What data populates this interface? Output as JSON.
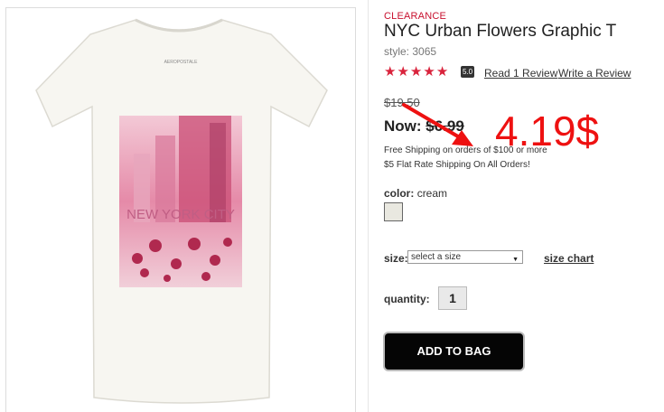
{
  "product": {
    "badge": "CLEARANCE",
    "title": "NYC Urban Flowers Graphic T",
    "style": "style: 3065",
    "rating_value": "5.0",
    "rating_stars": 5,
    "read_reviews": "Read 1 Review",
    "write_review": "Write a Review",
    "old_price": "$19.50",
    "now_label": "Now:",
    "now_price": "$6.99",
    "shipping_line1": "Free Shipping on orders of $100 or more",
    "shipping_line2": "$5 Flat Rate Shipping On All Orders!",
    "image_text": "NEW YORK CITY",
    "image_brand": "AEROPOSTALE"
  },
  "annotation": {
    "price_note": "4.19$",
    "color": "#ee1111"
  },
  "options": {
    "color_label": "color:",
    "color_value": "cream",
    "swatch_color": "#e9e8e0",
    "size_label": "size:",
    "size_placeholder": "select a size",
    "size_chart": "size chart",
    "quantity_label": "quantity:",
    "quantity_value": "1"
  },
  "actions": {
    "add_to_bag": "ADD TO BAG"
  },
  "colors": {
    "accent_red": "#c8102e",
    "star_red": "#d9233c",
    "button_bg": "#050505"
  },
  "icons": {
    "star": "star-icon",
    "caret": "chevron-down-icon",
    "arrow": "red-annotation-arrow"
  }
}
